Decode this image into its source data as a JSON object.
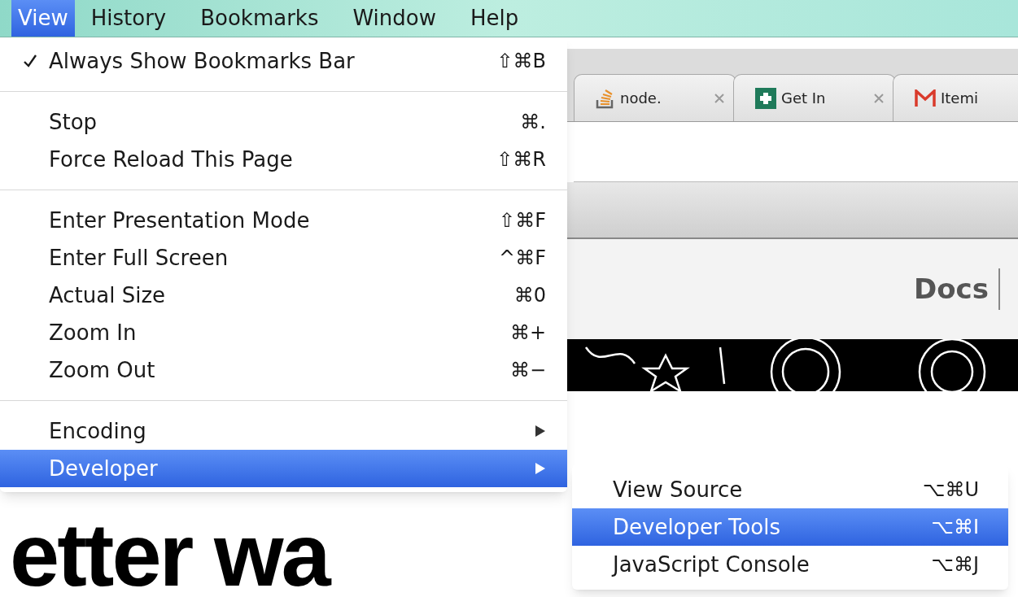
{
  "menubar": {
    "items": [
      {
        "label": "View",
        "selected": true
      },
      {
        "label": "History",
        "selected": false
      },
      {
        "label": "Bookmarks",
        "selected": false
      },
      {
        "label": "Window",
        "selected": false
      },
      {
        "label": "Help",
        "selected": false
      }
    ]
  },
  "view_menu": {
    "items": [
      {
        "kind": "item",
        "label": "Always Show Bookmarks Bar",
        "shortcut": "⇧⌘B",
        "checked": true,
        "selected": false
      },
      {
        "kind": "separator"
      },
      {
        "kind": "item",
        "label": "Stop",
        "shortcut": "⌘.",
        "checked": false,
        "selected": false
      },
      {
        "kind": "item",
        "label": "Force Reload This Page",
        "shortcut": "⇧⌘R",
        "checked": false,
        "selected": false
      },
      {
        "kind": "separator"
      },
      {
        "kind": "item",
        "label": "Enter Presentation Mode",
        "shortcut": "⇧⌘F",
        "checked": false,
        "selected": false
      },
      {
        "kind": "item",
        "label": "Enter Full Screen",
        "shortcut": "^⌘F",
        "checked": false,
        "selected": false
      },
      {
        "kind": "item",
        "label": "Actual Size",
        "shortcut": "⌘0",
        "checked": false,
        "selected": false
      },
      {
        "kind": "item",
        "label": "Zoom In",
        "shortcut": "⌘+",
        "checked": false,
        "selected": false
      },
      {
        "kind": "item",
        "label": "Zoom Out",
        "shortcut": "⌘−",
        "checked": false,
        "selected": false
      },
      {
        "kind": "separator"
      },
      {
        "kind": "submenu",
        "label": "Encoding",
        "checked": false,
        "selected": false
      },
      {
        "kind": "submenu",
        "label": "Developer",
        "checked": false,
        "selected": true
      }
    ]
  },
  "developer_submenu": {
    "items": [
      {
        "label": "View Source",
        "shortcut": "⌥⌘U",
        "selected": false
      },
      {
        "label": "Developer Tools",
        "shortcut": "⌥⌘I",
        "selected": true
      },
      {
        "label": "JavaScript Console",
        "shortcut": "⌥⌘J",
        "selected": false
      }
    ]
  },
  "browser": {
    "tabs": [
      {
        "kind": "stack",
        "label": "node."
      },
      {
        "kind": "plus",
        "label": "Get In"
      },
      {
        "kind": "mail",
        "label": "Itemi"
      }
    ],
    "page": {
      "nav_link": "Docs",
      "heading": "etter wa"
    }
  }
}
